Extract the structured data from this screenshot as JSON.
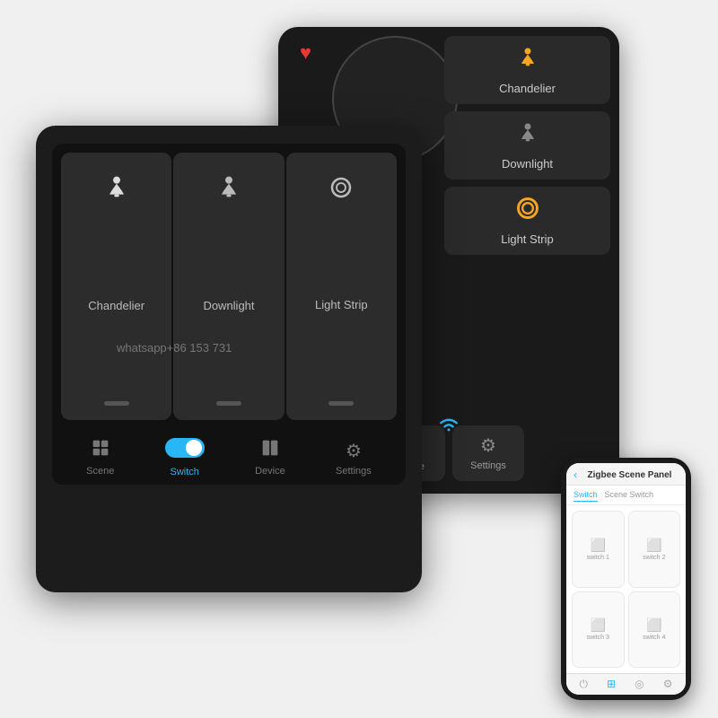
{
  "backPanel": {
    "heartIcon": "♥",
    "devices": [
      {
        "id": "chandelier",
        "label": "Chandelier",
        "icon": "🔔",
        "active": true
      },
      {
        "id": "downlight",
        "label": "Downlight",
        "icon": "🔔",
        "active": false
      },
      {
        "id": "lightstrip",
        "label": "Light Strip",
        "icon": "◯",
        "active": true
      }
    ],
    "bottomNav": [
      {
        "id": "device",
        "label": "Device",
        "icon": "⊞"
      },
      {
        "id": "settings",
        "label": "Settings",
        "icon": "⚙"
      }
    ]
  },
  "frontPanel": {
    "switches": [
      {
        "id": "chandelier",
        "label": "Chandelier",
        "icon": "🔔"
      },
      {
        "id": "downlight",
        "label": "Downlight",
        "icon": "🔔"
      },
      {
        "id": "lightstrip",
        "label": "Light Strip",
        "icon": "◯"
      }
    ],
    "bottomNav": [
      {
        "id": "scene",
        "label": "Scene",
        "icon": "⊞"
      },
      {
        "id": "switch",
        "label": "Switch",
        "icon": "toggle",
        "active": true
      },
      {
        "id": "device",
        "label": "Device",
        "icon": "⊞"
      },
      {
        "id": "settings",
        "label": "Settings",
        "icon": "⚙"
      }
    ]
  },
  "watermark": {
    "text": "whatsapp+86   153  731"
  },
  "phone": {
    "header": {
      "back": "‹",
      "title": "Zigbee Scene Panel"
    },
    "tabs": [
      {
        "id": "switch",
        "label": "Switch",
        "active": true
      },
      {
        "id": "sceneswitch",
        "label": "Scene Switch",
        "active": false
      }
    ],
    "switches": [
      {
        "id": "sw1",
        "label": "switch 1"
      },
      {
        "id": "sw2",
        "label": "switch 2"
      },
      {
        "id": "sw3",
        "label": "switch 3"
      },
      {
        "id": "sw4",
        "label": "switch 4"
      }
    ],
    "bottomIcons": [
      "⏻",
      "⊞",
      "◎",
      "⚙"
    ]
  }
}
